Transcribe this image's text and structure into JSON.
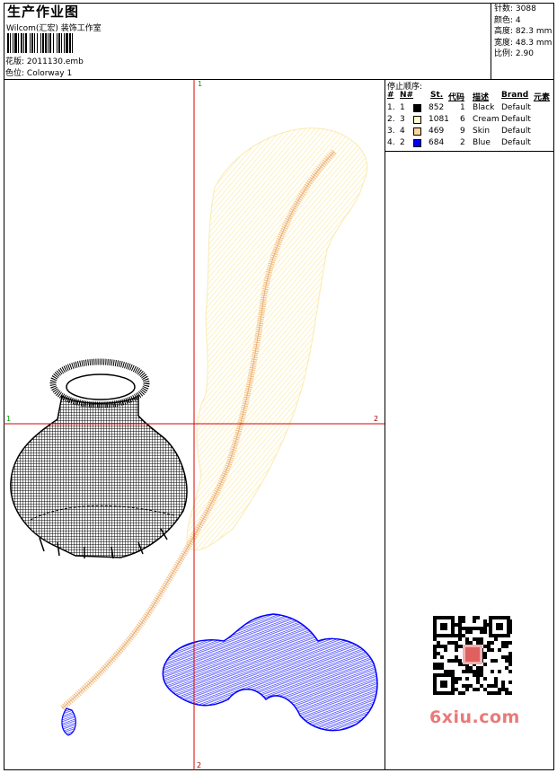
{
  "header": {
    "title": "生产作业图",
    "studio": "Wilcom(汇宏) 装饰工作室",
    "design_label": "花版:",
    "design_value": "2011130.emb",
    "colorway_label": "色位:",
    "colorway_value": "Colorway 1"
  },
  "stats": {
    "stitches_label": "针数:",
    "stitches_value": "3088",
    "colors_label": "颜色:",
    "colors_value": "4",
    "height_label": "高度:",
    "height_value": "82.3 mm",
    "width_label": "宽度:",
    "width_value": "48.3 mm",
    "scale_label": "比例:",
    "scale_value": "2.90"
  },
  "stop_sequence": {
    "title": "停止顺序:",
    "headers": {
      "num": "#",
      "n": "N#",
      "st": "St.",
      "code": "代码",
      "desc": "描述",
      "brand": "Brand",
      "element": "元素"
    },
    "rows": [
      {
        "num": "1.",
        "n": "1",
        "color": "#000000",
        "st": "852",
        "code": "1",
        "desc": "Black",
        "brand": "Default"
      },
      {
        "num": "2.",
        "n": "3",
        "color": "#fffbd0",
        "st": "1081",
        "code": "6",
        "desc": "Cream",
        "brand": "Default"
      },
      {
        "num": "3.",
        "n": "4",
        "color": "#fcd3a0",
        "st": "469",
        "code": "9",
        "desc": "Skin",
        "brand": "Default"
      },
      {
        "num": "4.",
        "n": "2",
        "color": "#0000ff",
        "st": "684",
        "code": "2",
        "desc": "Blue",
        "brand": "Default"
      }
    ]
  },
  "axes": {
    "top": "1",
    "left": "1",
    "right": "2",
    "bottom": "2"
  },
  "watermark": {
    "text": "6xiu.com"
  },
  "colors": {
    "axis": "#e00000",
    "axis_label": "#00a000",
    "black_thread": "#000000",
    "cream_thread": "#fdf3c0",
    "skin_thread": "#f6c48c",
    "blue_thread": "#0000ff"
  }
}
